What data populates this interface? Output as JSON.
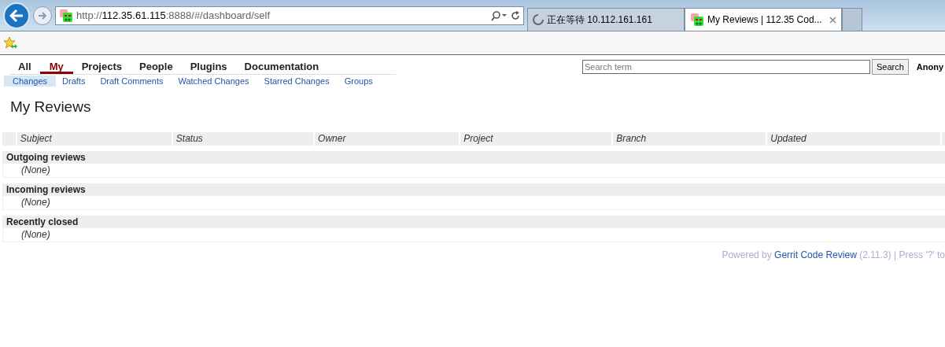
{
  "browser": {
    "url": {
      "scheme": "http://",
      "host": "112.35.61.115",
      "path": ":8888/#/dashboard/self"
    },
    "tabs": [
      {
        "title": "正在等待 10.112.161.161",
        "selected": false,
        "loading": true
      },
      {
        "title": "My Reviews | 112.35 Cod...",
        "selected": true,
        "loading": false
      }
    ]
  },
  "top_menu": [
    {
      "label": "All",
      "selected": false
    },
    {
      "label": "My",
      "selected": true
    },
    {
      "label": "Projects",
      "selected": false
    },
    {
      "label": "People",
      "selected": false
    },
    {
      "label": "Plugins",
      "selected": false
    },
    {
      "label": "Documentation",
      "selected": false
    }
  ],
  "sub_menu": [
    {
      "label": "Changes",
      "selected": true
    },
    {
      "label": "Drafts",
      "selected": false
    },
    {
      "label": "Draft Comments",
      "selected": false
    },
    {
      "label": "Watched Changes",
      "selected": false
    },
    {
      "label": "Starred Changes",
      "selected": false
    },
    {
      "label": "Groups",
      "selected": false
    }
  ],
  "search": {
    "placeholder": "Search term",
    "button": "Search"
  },
  "user": "Anony",
  "page_title": "My Reviews",
  "table": {
    "columns": [
      "Subject",
      "Status",
      "Owner",
      "Project",
      "Branch",
      "Updated"
    ],
    "sections": [
      {
        "title": "Outgoing reviews",
        "empty": "(None)"
      },
      {
        "title": "Incoming reviews",
        "empty": "(None)"
      },
      {
        "title": "Recently closed",
        "empty": "(None)"
      }
    ]
  },
  "footer": {
    "prefix": "Powered by",
    "link": "Gerrit Code Review",
    "suffix": "(2.11.3) | Press '?' to"
  }
}
